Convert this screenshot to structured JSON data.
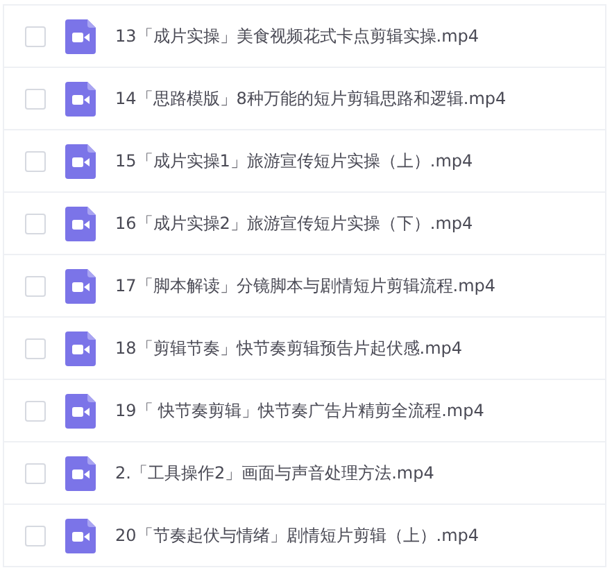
{
  "files": [
    {
      "name": "13「成片实操」美食视频花式卡点剪辑实操.mp4",
      "checked": false
    },
    {
      "name": "14「思路模版」8种万能的短片剪辑思路和逻辑.mp4",
      "checked": false
    },
    {
      "name": "15「成片实操1」旅游宣传短片实操（上）.mp4",
      "checked": false
    },
    {
      "name": "16「成片实操2」旅游宣传短片实操（下）.mp4",
      "checked": false
    },
    {
      "name": "17「脚本解读」分镜脚本与剧情短片剪辑流程.mp4",
      "checked": false
    },
    {
      "name": "18「剪辑节奏」快节奏剪辑预告片起伏感.mp4",
      "checked": false
    },
    {
      "name": "19「 快节奏剪辑」快节奏广告片精剪全流程.mp4",
      "checked": false
    },
    {
      "name": "2.「工具操作2」画面与声音处理方法.mp4",
      "checked": false
    },
    {
      "name": "20「节奏起伏与情绪」剧情短片剪辑（上）.mp4",
      "checked": false
    }
  ]
}
